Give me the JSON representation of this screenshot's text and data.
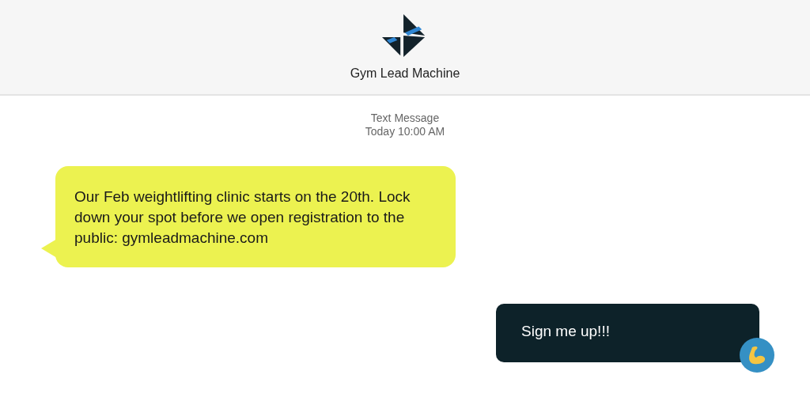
{
  "header": {
    "title": "Gym Lead Machine"
  },
  "meta": {
    "label": "Text Message",
    "time": "Today 10:00 AM"
  },
  "messages": [
    {
      "kind": "incoming",
      "text": "Our Feb weightlifting clinic starts on the 20th. Lock down your spot before we open registration to the public: gymleadmachine.com"
    },
    {
      "kind": "outgoing",
      "text": "Sign me up!!!"
    }
  ]
}
